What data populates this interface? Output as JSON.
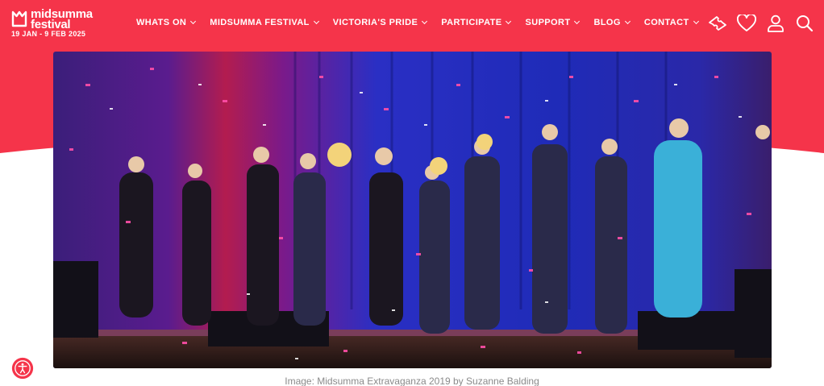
{
  "colors": {
    "brand": "#f5344a",
    "white": "#ffffff"
  },
  "logo": {
    "name": "midsumma\nfestival",
    "dates": "19 JAN - 9 FEB 2025"
  },
  "nav": [
    {
      "label": "WHATS ON"
    },
    {
      "label": "MIDSUMMA FESTIVAL"
    },
    {
      "label": "VICTORIA'S PRIDE"
    },
    {
      "label": "PARTICIPATE"
    },
    {
      "label": "SUPPORT"
    },
    {
      "label": "BLOG"
    },
    {
      "label": "CONTACT"
    }
  ],
  "header_icons": [
    "ticket-icon",
    "heart-icon",
    "user-icon",
    "search-icon"
  ],
  "hero": {
    "caption": "Image: Midsumma Extravaganza 2019 by Suzanne Balding"
  },
  "accessibility": {
    "icon": "accessibility-icon"
  }
}
